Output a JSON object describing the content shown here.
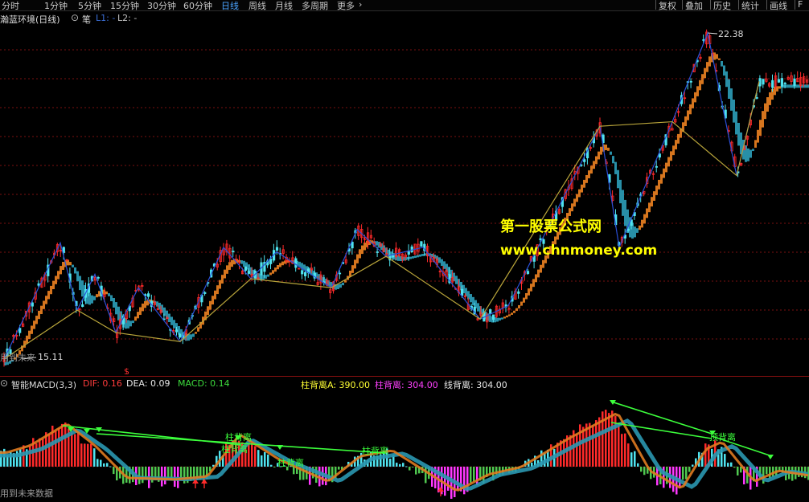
{
  "toolbar": {
    "timeframes": [
      "分时",
      "1分钟",
      "5分钟",
      "15分钟",
      "30分钟",
      "60分钟",
      "日线",
      "周线",
      "月线",
      "多周期",
      "更多"
    ],
    "active_timeframe": "日线",
    "right_buttons": [
      "复权",
      "叠加",
      "历史",
      "统计",
      "画线",
      "F"
    ]
  },
  "main_chart": {
    "title": "瀚蓝环境(日线)",
    "indicator_name": "笔",
    "l1_label": "L1: -",
    "l2_label": "L2: -",
    "high_label": "22.38",
    "low_label": "15.11",
    "bottom_note": "用到未来",
    "dollar_mark": "$"
  },
  "macd_panel": {
    "title": "智能MACD(3,3)",
    "dif_label": "DIF: 0.16",
    "dea_label": "DEA: 0.09",
    "macd_label": "MACD: 0.14",
    "div_a_label": "柱背离A: 390.00",
    "div_b_label": "柱背离: 304.00",
    "div_line_label": "线背离: 304.00",
    "chart_labels": [
      "柱背离",
      "柱背离",
      "柱背离",
      "顶背离",
      "柱背离"
    ],
    "bottom_note": "用到未来数据"
  },
  "watermark": {
    "line1": "第一股票公式网",
    "line2": "www.chnmoney.com"
  },
  "colors": {
    "up": "#ff2a2a",
    "down": "#4fe3ef",
    "ribbon_orange": "#e07b20",
    "ribbon_teal": "#2a97b0",
    "zigzag": "#b8a43a",
    "watermark": "#ffff00",
    "active_tab": "#4aa3ff"
  },
  "chart_data": {
    "type": "candlestick",
    "title": "瀚蓝环境(日线)",
    "price_range": [
      15.11,
      22.38
    ],
    "marked_high": 22.38,
    "marked_low": 15.11,
    "zigzag_pivots": [
      15.11,
      17.7,
      16.2,
      17.0,
      15.7,
      16.7,
      15.5,
      17.6,
      16.9,
      17.5,
      16.7,
      18.0,
      17.4,
      17.6,
      16.0,
      16.3,
      20.3,
      17.6,
      20.4,
      22.38,
      19.2,
      21.3
    ],
    "macd": {
      "dif": 0.16,
      "dea": 0.09,
      "macd": 0.14
    }
  }
}
